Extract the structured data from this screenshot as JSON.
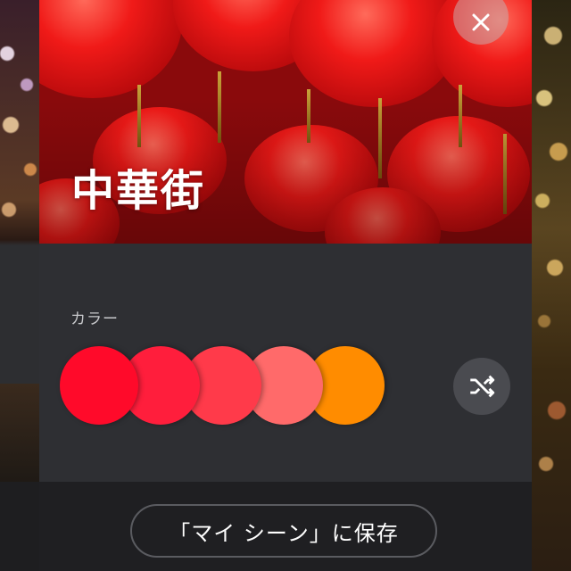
{
  "header": {
    "title": "中華街",
    "close_icon": "close-icon"
  },
  "colors": {
    "label": "カラー",
    "swatches": [
      "#ff0a2a",
      "#ff1e3c",
      "#ff3a4a",
      "#ff6a6a",
      "#ff8c00"
    ],
    "shuffle_icon": "shuffle-icon"
  },
  "footer": {
    "save_label": "「マイ シーン」に保存"
  }
}
